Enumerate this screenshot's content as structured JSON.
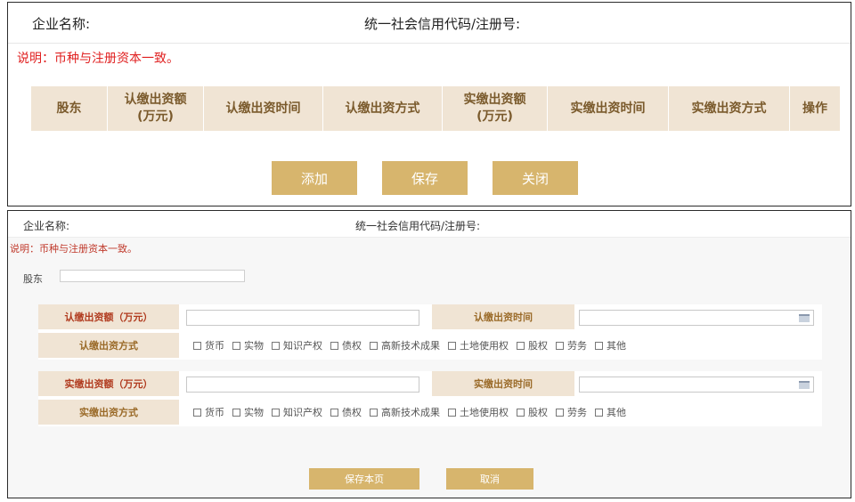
{
  "top_form": {
    "company_label": "企业名称:",
    "credit_label": "统一社会信用代码/注册号:",
    "note": "说明：币种与注册资本一致。",
    "columns": [
      {
        "label": "股东"
      },
      {
        "label": "认缴出资额\n(万元)"
      },
      {
        "label": "认缴出资时间"
      },
      {
        "label": "认缴出资方式"
      },
      {
        "label": "实缴出资额\n(万元)"
      },
      {
        "label": "实缴出资时间"
      },
      {
        "label": "实缴出资方式"
      },
      {
        "label": "操作"
      }
    ],
    "buttons": {
      "add": "添加",
      "save": "保存",
      "close": "关闭"
    }
  },
  "detail_form": {
    "company_label": "企业名称:",
    "credit_label": "统一社会信用代码/注册号:",
    "note": "说明：币种与注册资本一致。",
    "shareholder_label": "股东",
    "shareholder_value": "",
    "subscribed": {
      "amount_label": "认缴出资额（万元）",
      "amount_value": "",
      "time_label": "认缴出资时间",
      "time_value": "",
      "mode_label": "认缴出资方式"
    },
    "paid": {
      "amount_label": "实缴出资额（万元）",
      "amount_value": "",
      "time_label": "实缴出资时间",
      "time_value": "",
      "mode_label": "实缴出资方式"
    },
    "options": [
      "货币",
      "实物",
      "知识产权",
      "债权",
      "高新技术成果",
      "土地使用权",
      "股权",
      "劳务",
      "其他"
    ],
    "buttons": {
      "save_page": "保存本页",
      "cancel": "取消"
    },
    "accent_color": "#d7b56d"
  }
}
